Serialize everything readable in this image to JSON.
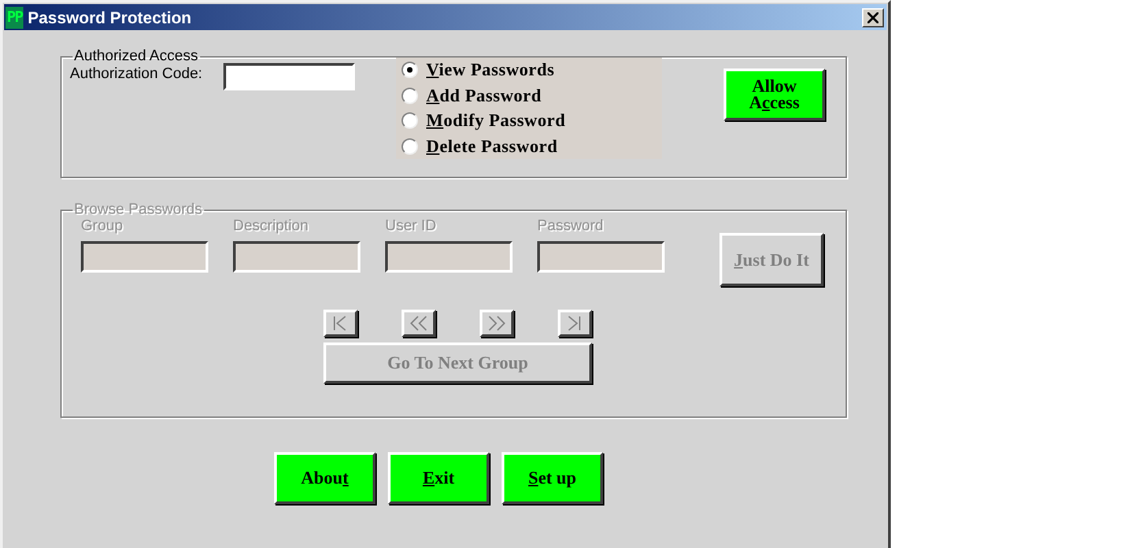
{
  "window": {
    "app_icon": "PP",
    "title": "Password Protection"
  },
  "authorized_access": {
    "title": "Authorized Access",
    "code_label": "Authorization Code:",
    "options": [
      {
        "key": "V",
        "after": "iew Passwords",
        "selected": true
      },
      {
        "key": "A",
        "after": "dd Password",
        "selected": false
      },
      {
        "key": "M",
        "after": "odify Password",
        "selected": false
      },
      {
        "key": "D",
        "after": "elete Password",
        "selected": false
      }
    ],
    "allow_button": {
      "lines": [
        {
          "before": "Allow"
        },
        {
          "before": "A",
          "key": "c",
          "after": "cess"
        }
      ],
      "disabled": false
    }
  },
  "browse_passwords": {
    "title": "Browse Passwords",
    "disabled": true,
    "fields": [
      {
        "label": "Group"
      },
      {
        "label": "Description"
      },
      {
        "label": "User ID"
      },
      {
        "label": "Password"
      }
    ],
    "just_do_it": {
      "key": "J",
      "after": "ust Do It",
      "disabled": true
    },
    "nav_buttons": [
      {
        "kind": "first",
        "disabled": true
      },
      {
        "kind": "prev",
        "disabled": true
      },
      {
        "kind": "next",
        "disabled": true
      },
      {
        "kind": "last",
        "disabled": true
      }
    ],
    "next_group_button": {
      "before": "Go To Next Group",
      "disabled": true
    }
  },
  "buttons": [
    {
      "before": "Abou",
      "key": "t"
    },
    {
      "key": "E",
      "after": "xit"
    },
    {
      "key": "S",
      "after": "et up"
    }
  ]
}
